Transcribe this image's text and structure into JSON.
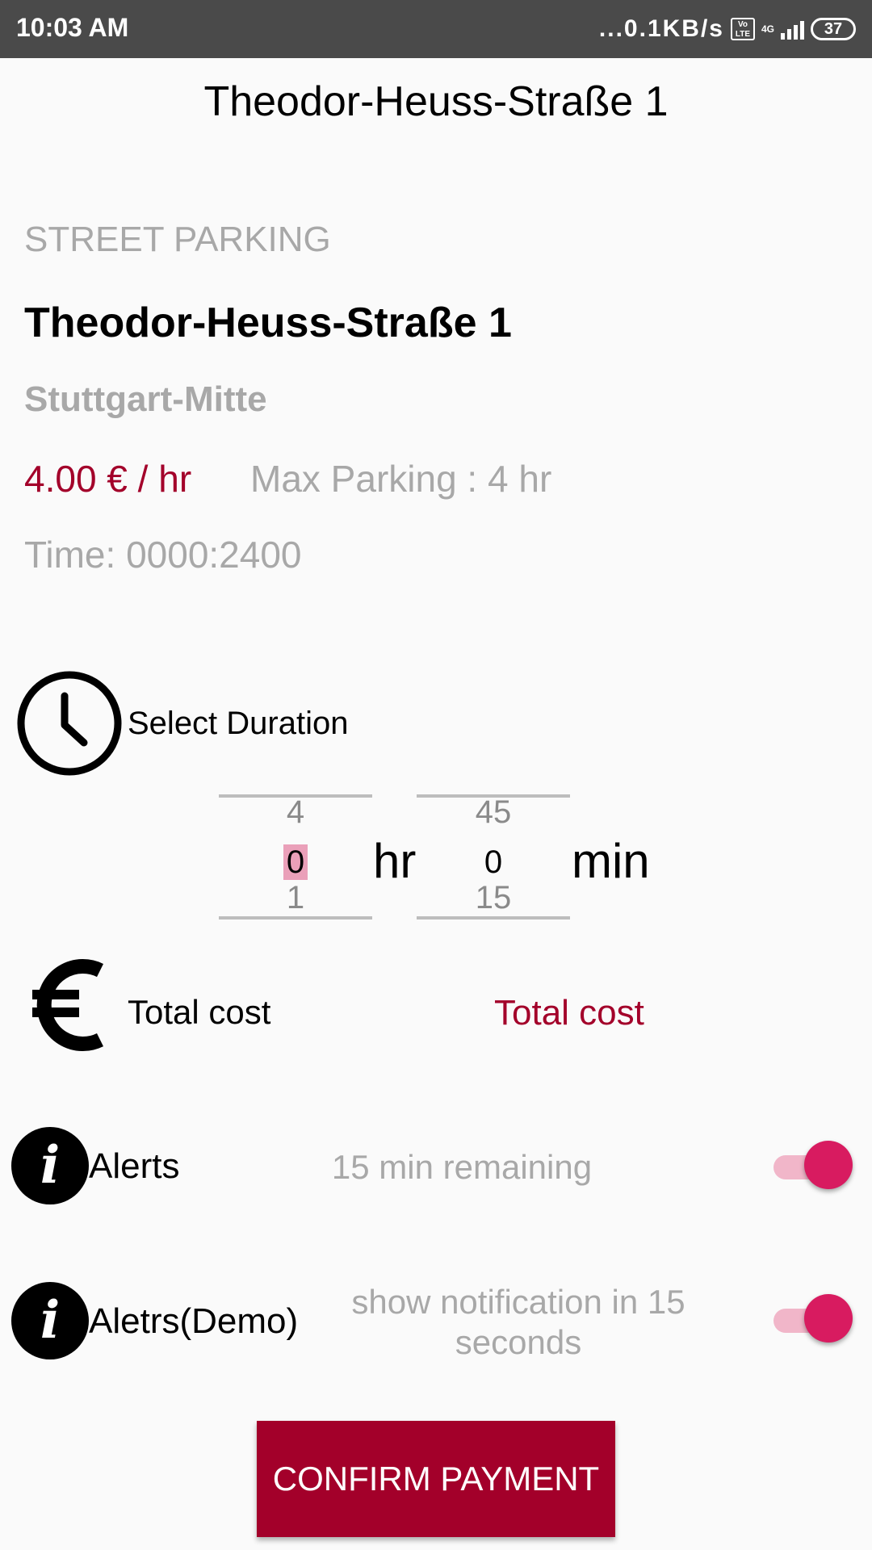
{
  "status_bar": {
    "time": "10:03 AM",
    "net_speed": "...0.1KB/s",
    "volte_top": "Vo",
    "volte_bottom": "LTE",
    "network": "4G",
    "battery": "37"
  },
  "header": {
    "title": "Theodor-Heuss-Straße 1"
  },
  "details": {
    "section_label": "STREET PARKING",
    "street": "Theodor-Heuss-Straße 1",
    "district": "Stuttgart-Mitte",
    "price": "4.00 € / hr",
    "max_parking": "Max Parking : 4 hr",
    "time": "Time: 0000:2400"
  },
  "duration": {
    "icon": "clock-icon",
    "label": "Select Duration",
    "hours": {
      "prev": "4",
      "current": "0",
      "next": "1",
      "unit": "hr"
    },
    "minutes": {
      "prev": "45",
      "current": "0",
      "next": "15",
      "unit": "min"
    }
  },
  "cost": {
    "icon": "euro-icon",
    "label": "Total cost",
    "value": "Total cost"
  },
  "alerts": [
    {
      "icon": "info-icon",
      "glyph": "i",
      "label": "Alerts",
      "description": "15 min remaining",
      "enabled": true
    },
    {
      "icon": "info-icon",
      "glyph": "i",
      "label": "Aletrs(Demo)",
      "description": "show notification in 15 seconds",
      "enabled": true
    }
  ],
  "confirm_button": {
    "label": "CONFIRM PAYMENT"
  },
  "colors": {
    "accent": "#a3002a",
    "toggle_on": "#d81b60",
    "status_bar": "#4a4a4a"
  }
}
